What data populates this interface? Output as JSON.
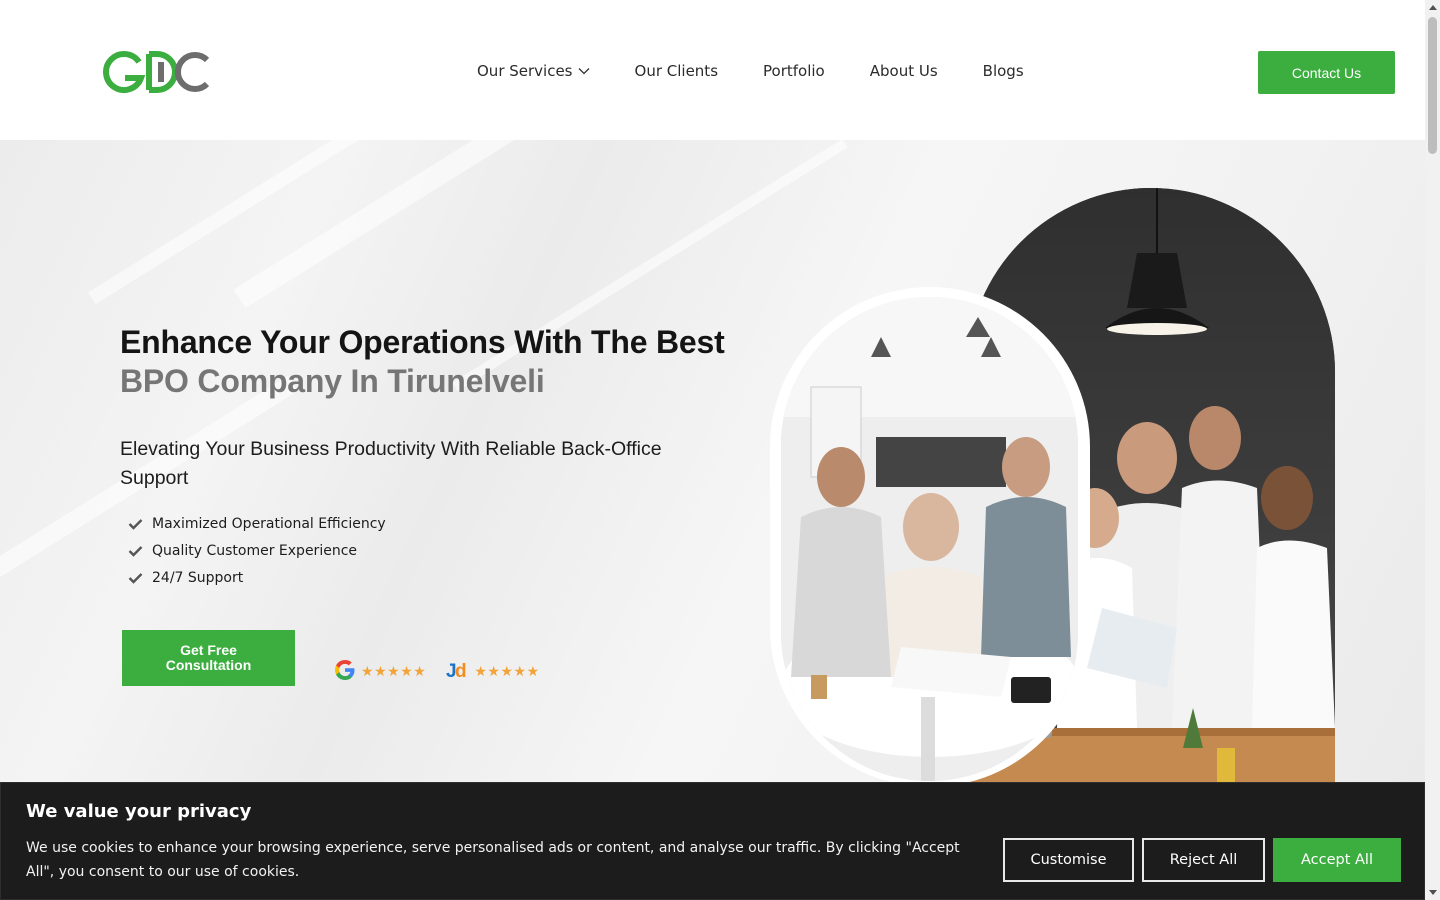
{
  "header": {
    "logo_text": "GDC",
    "nav": [
      {
        "label": "Our Services",
        "has_dropdown": true
      },
      {
        "label": "Our Clients"
      },
      {
        "label": "Portfolio"
      },
      {
        "label": "About Us"
      },
      {
        "label": "Blogs"
      }
    ],
    "contact_label": "Contact Us"
  },
  "hero": {
    "title_line1": "Enhance Your Operations With The Best",
    "title_line2": "BPO Company In Tirunelveli",
    "subtitle": "Elevating Your Business Productivity With Reliable Back-Office Support",
    "features": [
      "Maximized Operational Efficiency",
      "Quality Customer Experience",
      "24/7 Support"
    ],
    "cta_label": "Get Free Consultation",
    "ratings": [
      {
        "icon": "google-icon",
        "stars": 5
      },
      {
        "icon": "justdial-icon",
        "stars": 5
      }
    ]
  },
  "cookie": {
    "title": "We value your privacy",
    "text": "We use cookies to enhance your browsing experience, serve personalised ads or content, and analyse our traffic. By clicking \"Accept All\", you consent to our use of cookies.",
    "customise_label": "Customise",
    "reject_label": "Reject All",
    "accept_label": "Accept All"
  },
  "colors": {
    "brand_green": "#3bae3f",
    "logo_gray": "#6d6d6d",
    "banner_bg": "#1c1c1c"
  }
}
